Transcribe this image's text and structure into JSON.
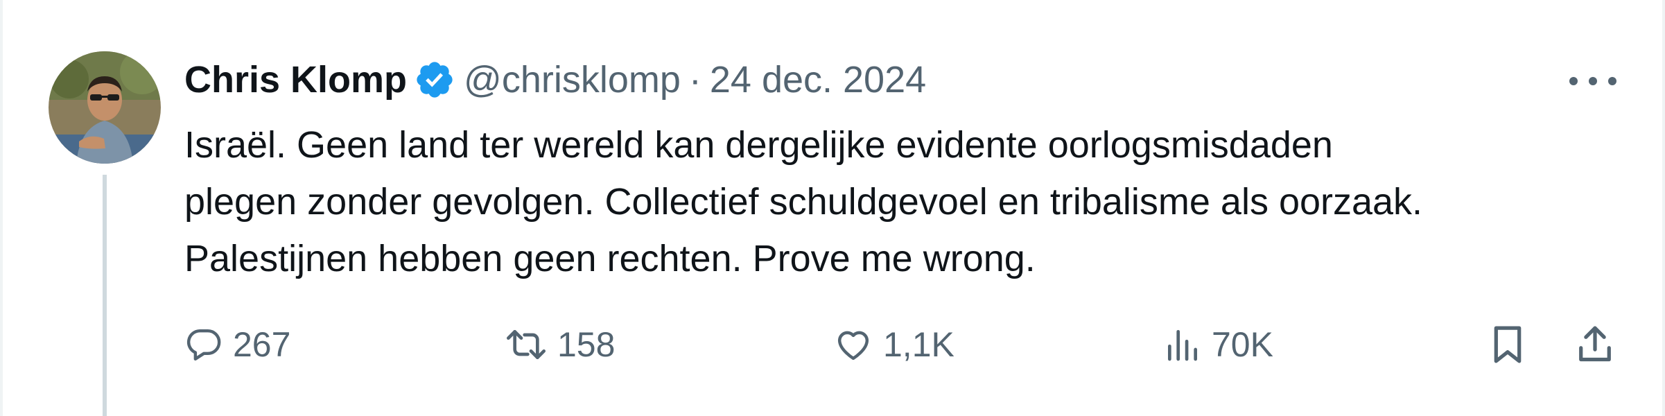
{
  "tweet": {
    "author": {
      "display_name": "Chris Klomp",
      "handle": "@chrisklomp",
      "verified": true
    },
    "separator": "·",
    "date": "24 dec. 2024",
    "text_lines": [
      "Israël. Geen land ter wereld kan dergelijke evidente oorlogsmisdaden",
      "plegen zonder gevolgen. Collectief schuldgevoel en tribalisme als oorzaak.",
      "Palestijnen hebben geen rechten. Prove me wrong."
    ],
    "actions": {
      "replies": "267",
      "reposts": "158",
      "likes": "1,1K",
      "views": "70K"
    },
    "icons": {
      "more": "more-dots-icon",
      "reply": "reply-bubble-icon",
      "repost": "repost-arrows-icon",
      "like": "heart-icon",
      "views": "bar-chart-icon",
      "bookmark": "bookmark-icon",
      "share": "share-upload-icon",
      "verified": "verified-badge-icon"
    },
    "colors": {
      "text": "#0f1419",
      "secondary": "#536471",
      "verified_blue": "#1d9bf0",
      "thread_line": "#cfd9de"
    }
  }
}
